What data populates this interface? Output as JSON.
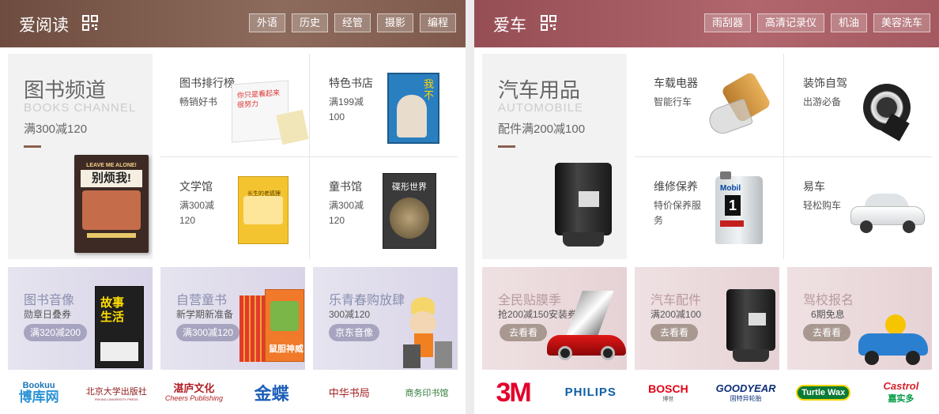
{
  "left": {
    "title": "爱阅读",
    "tags": [
      "外语",
      "历史",
      "经管",
      "摄影",
      "编程"
    ],
    "feature": {
      "title": "图书频道",
      "subtitle": "BOOKS CHANNEL",
      "promo": "满300减120",
      "book_title": "别烦我!",
      "book_en": "LEAVE ME ALONE!"
    },
    "cells": [
      {
        "title": "图书排行榜",
        "sub": "畅销好书",
        "cover": "你只是看起来很努力"
      },
      {
        "title": "特色书店",
        "sub": "满199减100",
        "cover": "我不"
      },
      {
        "title": "文学馆",
        "sub": "满300减120",
        "cover": "长生的老狐狸"
      },
      {
        "title": "童书馆",
        "sub": "满300减120",
        "cover": "碟形世界"
      }
    ],
    "promos": [
      {
        "title": "图书音像",
        "sub": "勋章日叠券",
        "btn": "满320减200",
        "cover": "故事生活"
      },
      {
        "title": "自营童书",
        "sub": "新学期新准备",
        "btn": "满300减120",
        "cover": "鼠胆神威"
      },
      {
        "title": "乐青春购放肆",
        "sub": "300减120",
        "btn": "京东音像"
      }
    ],
    "logos": [
      {
        "name": "Bookuu",
        "cn": "博库网"
      },
      {
        "name": "北京大学出版社",
        "en": "PEKING UNIVERSITY PRESS"
      },
      {
        "name": "湛庐文化",
        "en": "Cheers Publishing"
      },
      {
        "name": "金蝶"
      },
      {
        "name": "中华书局"
      },
      {
        "name": "商务印书馆"
      }
    ]
  },
  "right": {
    "title": "爱车",
    "tags": [
      "雨刮器",
      "高清记录仪",
      "机油",
      "美容洗车"
    ],
    "feature": {
      "title": "汽车用品",
      "subtitle": "AUTOMOBILE",
      "promo": "配件满200减100"
    },
    "cells": [
      {
        "title": "车载电器",
        "sub": "智能行车"
      },
      {
        "title": "装饰自驾",
        "sub": "出游必备"
      },
      {
        "title": "维修保养",
        "sub": "特价保养服务",
        "oil_brand": "Mobil",
        "oil_num": "1"
      },
      {
        "title": "易车",
        "sub": "轻松购车"
      }
    ],
    "promos": [
      {
        "title": "全民贴膜季",
        "sub": "抢200减150安装券",
        "btn": "去看看"
      },
      {
        "title": "汽车配件",
        "sub": "满200减100",
        "btn": "去看看"
      },
      {
        "title": "驾校报名",
        "sub": "6期免息",
        "btn": "去看看"
      }
    ],
    "logos": [
      {
        "name": "3M"
      },
      {
        "name": "PHILIPS"
      },
      {
        "name": "BOSCH",
        "cn": "博世"
      },
      {
        "name": "GOODYEAR",
        "cn": "固特异轮胎"
      },
      {
        "name": "Turtle Wax"
      },
      {
        "name": "Castrol",
        "cn": "嘉实多"
      }
    ]
  },
  "colors": {
    "left_header": "#7f5a4c",
    "right_header": "#a45a60",
    "accent": "#8a6050"
  }
}
